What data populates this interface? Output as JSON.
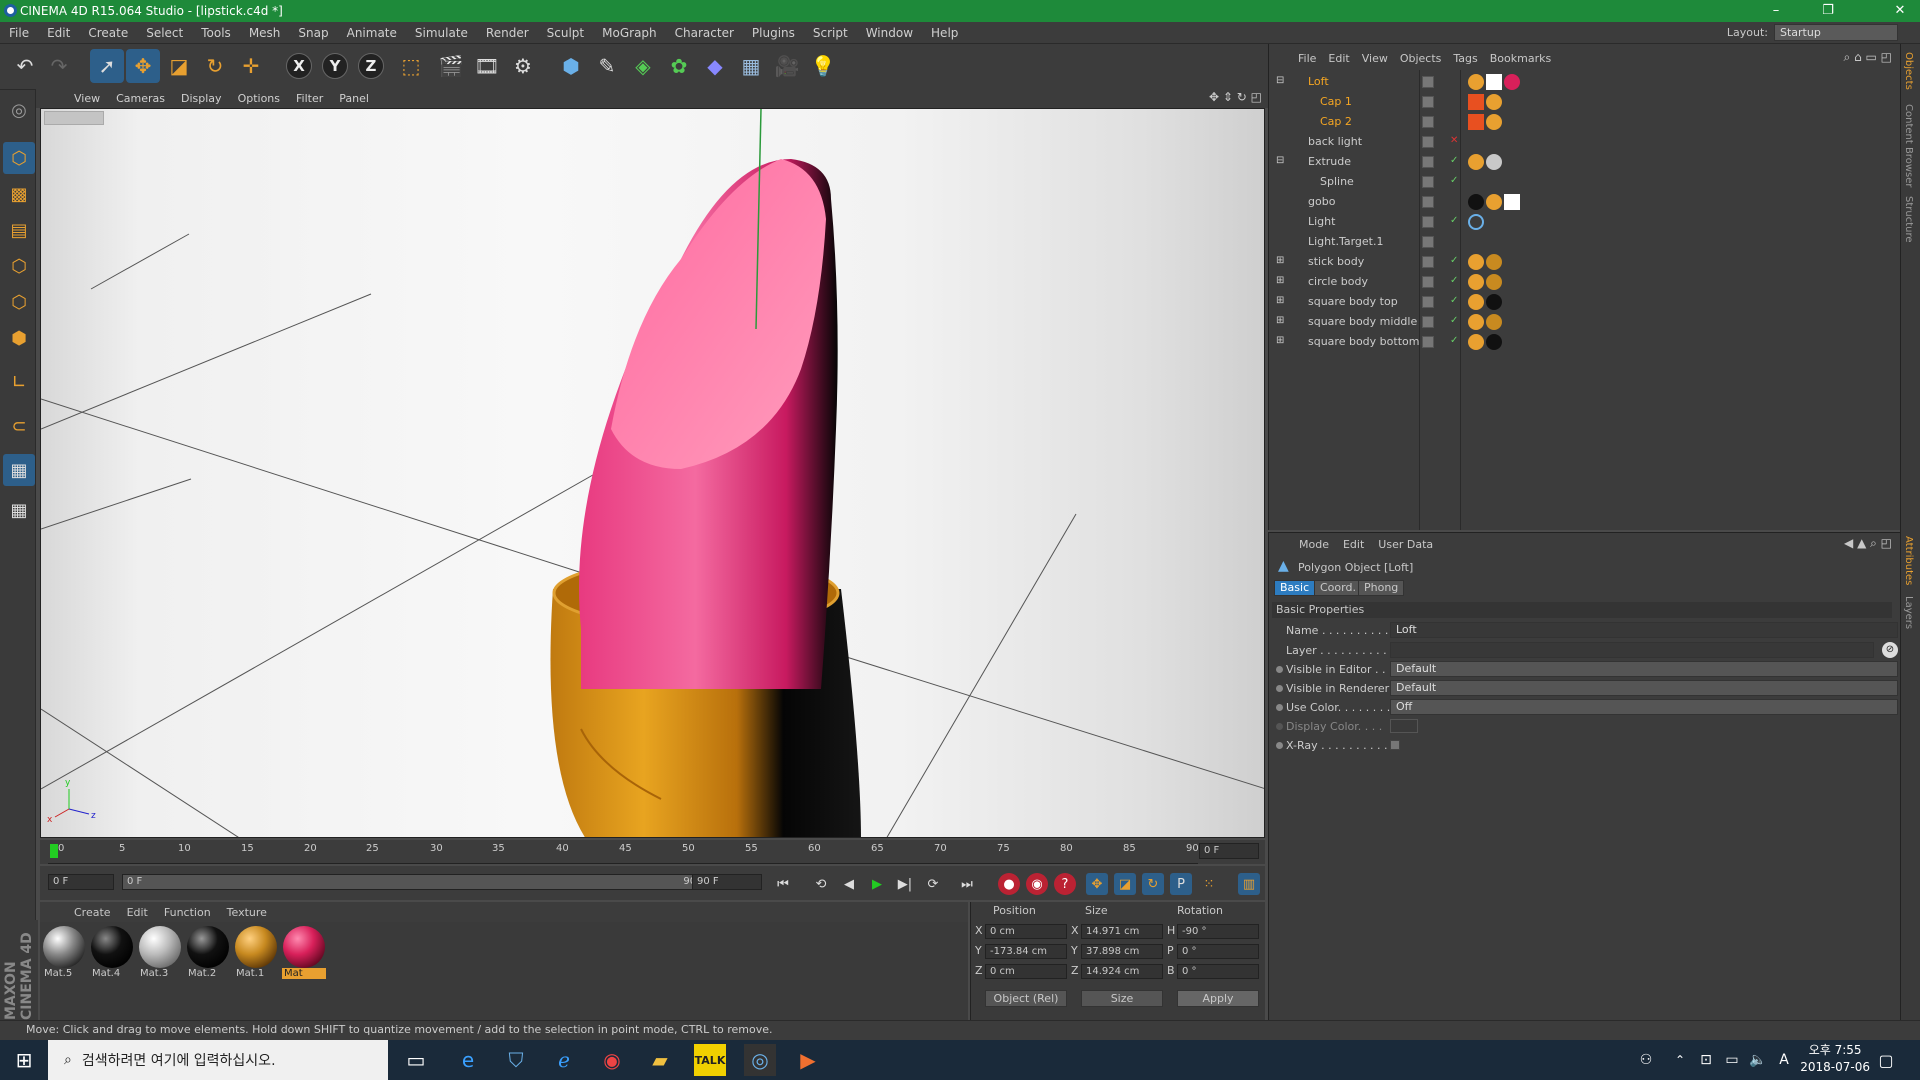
{
  "window": {
    "title": "CINEMA 4D R15.064 Studio - [lipstick.c4d *]",
    "min": "–",
    "max": "❐",
    "close": "✕"
  },
  "menu": [
    "File",
    "Edit",
    "Create",
    "Select",
    "Tools",
    "Mesh",
    "Snap",
    "Animate",
    "Simulate",
    "Render",
    "Sculpt",
    "MoGraph",
    "Character",
    "Plugins",
    "Script",
    "Window",
    "Help"
  ],
  "layout": {
    "label": "Layout:",
    "value": "Startup"
  },
  "viewport_menu": [
    "View",
    "Cameras",
    "Display",
    "Options",
    "Filter",
    "Panel"
  ],
  "timeline": {
    "ticks": [
      "0",
      "5",
      "10",
      "15",
      "20",
      "25",
      "30",
      "35",
      "40",
      "45",
      "50",
      "55",
      "60",
      "65",
      "70",
      "75",
      "80",
      "85",
      "90"
    ],
    "current": "0 F",
    "start": "0 F",
    "range_start": "0 F",
    "range_end": "90 F",
    "end": "90 F"
  },
  "material_menu": [
    "Create",
    "Edit",
    "Function",
    "Texture"
  ],
  "materials": [
    {
      "name": "Mat.5",
      "color": "#707070"
    },
    {
      "name": "Mat.4",
      "color": "#0a0a0a"
    },
    {
      "name": "Mat.3",
      "color": "#c8c8c8"
    },
    {
      "name": "Mat.2",
      "color": "#111111"
    },
    {
      "name": "Mat.1",
      "color": "#c88a20"
    },
    {
      "name": "Mat",
      "color": "#d8205a"
    }
  ],
  "coords": {
    "headers": [
      "Position",
      "Size",
      "Rotation"
    ],
    "rows": [
      {
        "axis": "X",
        "pos": "0 cm",
        "saxis": "X",
        "size": "14.971 cm",
        "raxis": "H",
        "rot": "-90 °"
      },
      {
        "axis": "Y",
        "pos": "-173.84 cm",
        "saxis": "Y",
        "size": "37.898 cm",
        "raxis": "P",
        "rot": "0 °"
      },
      {
        "axis": "Z",
        "pos": "0 cm",
        "saxis": "Z",
        "size": "14.924 cm",
        "raxis": "B",
        "rot": "0 °"
      }
    ],
    "mode": "Object (Rel)",
    "sizemode": "Size",
    "apply": "Apply"
  },
  "status": "Move: Click and drag to move elements. Hold down SHIFT to quantize movement / add to the selection in point mode, CTRL to remove.",
  "maxon": "MAXON CINEMA 4D",
  "object_menu": [
    "File",
    "Edit",
    "View",
    "Objects",
    "Tags",
    "Bookmarks"
  ],
  "objects": [
    {
      "name": "Loft",
      "active": true,
      "indent": 1,
      "tags": [
        "#e8a030",
        "#ffffff",
        "#d8205a"
      ]
    },
    {
      "name": "Cap 1",
      "active": true,
      "indent": 2,
      "tags": [
        "#e85020",
        "#e8a030"
      ]
    },
    {
      "name": "Cap 2",
      "active": true,
      "indent": 2,
      "tags": [
        "#e85020",
        "#e8a030"
      ]
    },
    {
      "name": "back light",
      "active": false,
      "indent": 1,
      "tags": []
    },
    {
      "name": "Extrude",
      "active": false,
      "indent": 1,
      "tags": [
        "#e8a030",
        "#c8c8c8"
      ]
    },
    {
      "name": "Spline",
      "active": false,
      "indent": 2,
      "tags": []
    },
    {
      "name": "gobo",
      "active": false,
      "indent": 1,
      "tags": [
        "#111111",
        "#e8a030",
        "#ffffff"
      ]
    },
    {
      "name": "Light",
      "active": false,
      "indent": 1,
      "tags": [
        "#2d5f8a"
      ]
    },
    {
      "name": "Light.Target.1",
      "active": false,
      "indent": 1,
      "tags": []
    },
    {
      "name": "stick body",
      "active": false,
      "indent": 1,
      "tags": [
        "#e8a030",
        "#c88a20"
      ]
    },
    {
      "name": "circle body",
      "active": false,
      "indent": 1,
      "tags": [
        "#e8a030",
        "#c88a20"
      ]
    },
    {
      "name": "square body top",
      "active": false,
      "indent": 1,
      "tags": [
        "#e8a030",
        "#111111"
      ]
    },
    {
      "name": "square body middle",
      "active": false,
      "indent": 1,
      "tags": [
        "#e8a030",
        "#c88a20"
      ]
    },
    {
      "name": "square body bottom",
      "active": false,
      "indent": 1,
      "tags": [
        "#e8a030",
        "#111111"
      ]
    }
  ],
  "attr_menu": [
    "Mode",
    "Edit",
    "User Data"
  ],
  "attr": {
    "title": "Polygon Object [Loft]",
    "tabs": [
      "Basic",
      "Coord.",
      "Phong"
    ],
    "section": "Basic Properties",
    "rows": [
      {
        "label": "Name . . . . . . . . . . .",
        "value": "Loft",
        "type": "text"
      },
      {
        "label": "Layer . . . . . . . . . . .",
        "value": "",
        "type": "text"
      },
      {
        "label": "Visible in Editor . .",
        "value": "Default",
        "type": "select"
      },
      {
        "label": "Visible in Renderer",
        "value": "Default",
        "type": "select"
      },
      {
        "label": "Use Color. . . . . . . .",
        "value": "Off",
        "type": "select"
      },
      {
        "label": "Display Color. . . .",
        "value": "",
        "type": "color"
      },
      {
        "label": "X-Ray . . . . . . . . . .",
        "value": "",
        "type": "check"
      }
    ]
  },
  "right_tabs": [
    "Objects",
    "Content Browser",
    "Structure",
    "Attributes",
    "Layers"
  ],
  "taskbar": {
    "search": "검색하려면 여기에 입력하십시오.",
    "time": "오후 7:55",
    "date": "2018-07-06",
    "ime": "A"
  }
}
